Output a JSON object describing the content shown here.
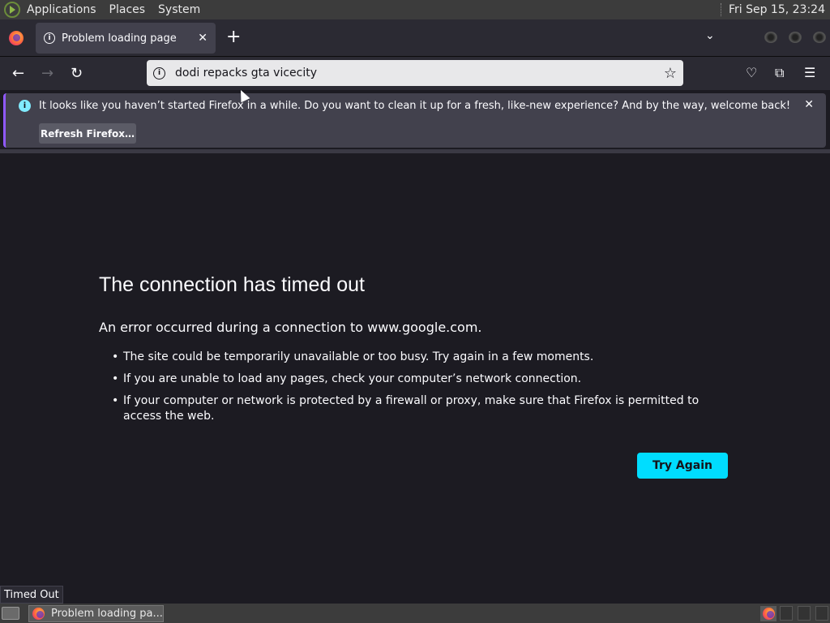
{
  "system_panel": {
    "menus": [
      "Applications",
      "Places",
      "System"
    ],
    "clock": "Fri Sep 15, 23:24"
  },
  "tab": {
    "title": "Problem loading page"
  },
  "navbar": {
    "url": "dodi repacks gta vicecity"
  },
  "notification": {
    "message": "It looks like you haven’t started Firefox in a while. Do you want to clean it up for a fresh, like-new experience? And by the way, welcome back!",
    "button": "Refresh Firefox…"
  },
  "error": {
    "title": "The connection has timed out",
    "subtitle": "An error occurred during a connection to www.google.com.",
    "bullets": [
      "The site could be temporarily unavailable or too busy. Try again in a few moments.",
      "If you are unable to load any pages, check your computer’s network connection.",
      "If your computer or network is protected by a firewall or proxy, make sure that Firefox is permitted to access the web."
    ],
    "button": "Try Again"
  },
  "status_text": "Timed Out",
  "taskbar": {
    "task_label": "Problem loading pa..."
  },
  "colors": {
    "accent": "#00ddff",
    "content_bg": "#1c1b22",
    "toolbar_bg": "#2b2a33"
  }
}
